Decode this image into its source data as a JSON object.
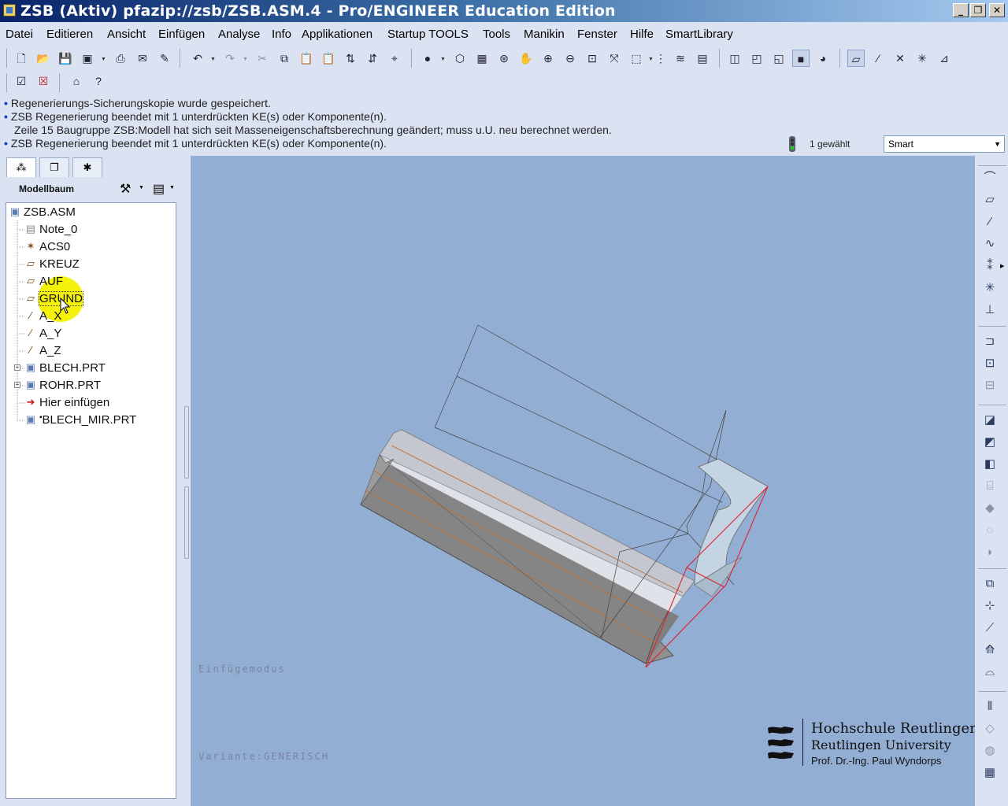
{
  "window": {
    "title": "ZSB (Aktiv) pfazip://zsb/ZSB.ASM.4 - Pro/ENGINEER Education Edition",
    "controls": {
      "minimize": "_",
      "restore": "❐",
      "close": "✕"
    }
  },
  "menu": [
    "Datei",
    "Editieren",
    "Ansicht",
    "Einfügen",
    "Analyse",
    "Info",
    "Applikationen",
    "Startup TOOLS",
    "Tools",
    "Manikin",
    "Fenster",
    "Hilfe",
    "SmartLibrary"
  ],
  "messages": [
    {
      "bullet": true,
      "text": "Regenerierungs-Sicherungskopie wurde gespeichert."
    },
    {
      "bullet": true,
      "text": "ZSB Regenerierung beendet mit 1 unterdrückten KE(s) oder Komponente(n)."
    },
    {
      "bullet": false,
      "text": "Zeile 15 Baugruppe ZSB:Modell hat sich seit Masseneigenschaftsberechnung geändert; muss u.U. neu berechnet werden."
    },
    {
      "bullet": true,
      "text": "ZSB Regenerierung beendet mit 1 unterdrückten KE(s) oder Komponente(n)."
    }
  ],
  "status": {
    "selected_count": "1 gewählt",
    "filter_value": "Smart"
  },
  "model_tree": {
    "title": "Modellbaum",
    "items": [
      {
        "label": "ZSB.ASM",
        "icon": "assembly-icon"
      },
      {
        "label": "Note_0",
        "icon": "note-icon"
      },
      {
        "label": "ACS0",
        "icon": "coordinate-system-icon"
      },
      {
        "label": "KREUZ",
        "icon": "datum-plane-icon"
      },
      {
        "label": "AUF",
        "icon": "datum-plane-icon"
      },
      {
        "label": "GRUND",
        "icon": "datum-plane-icon"
      },
      {
        "label": "A_X",
        "icon": "datum-axis-icon"
      },
      {
        "label": "A_Y",
        "icon": "datum-axis-icon"
      },
      {
        "label": "A_Z",
        "icon": "datum-axis-icon"
      },
      {
        "label": "BLECH.PRT",
        "icon": "part-icon"
      },
      {
        "label": "ROHR.PRT",
        "icon": "part-icon"
      },
      {
        "label": "Hier einfügen",
        "icon": "insert-here-arrow-icon"
      },
      {
        "label": "BLECH_MIR.PRT",
        "icon": "part-icon"
      }
    ]
  },
  "viewport": {
    "mode_text": "Einfügemodus",
    "variant_text": "Variante:GENERISCH",
    "background_color": "#93aed3",
    "logo": {
      "line1": "Hochschule Reutlingen",
      "line2": "Reutlingen University",
      "line3": "Prof. Dr.-Ing. Paul Wyndorps"
    }
  },
  "colors": {
    "title_bar": "#0a246a",
    "panel_bg": "#dbe3f2",
    "highlight": "#f4f10a",
    "bullet": "#1c3cc8"
  }
}
